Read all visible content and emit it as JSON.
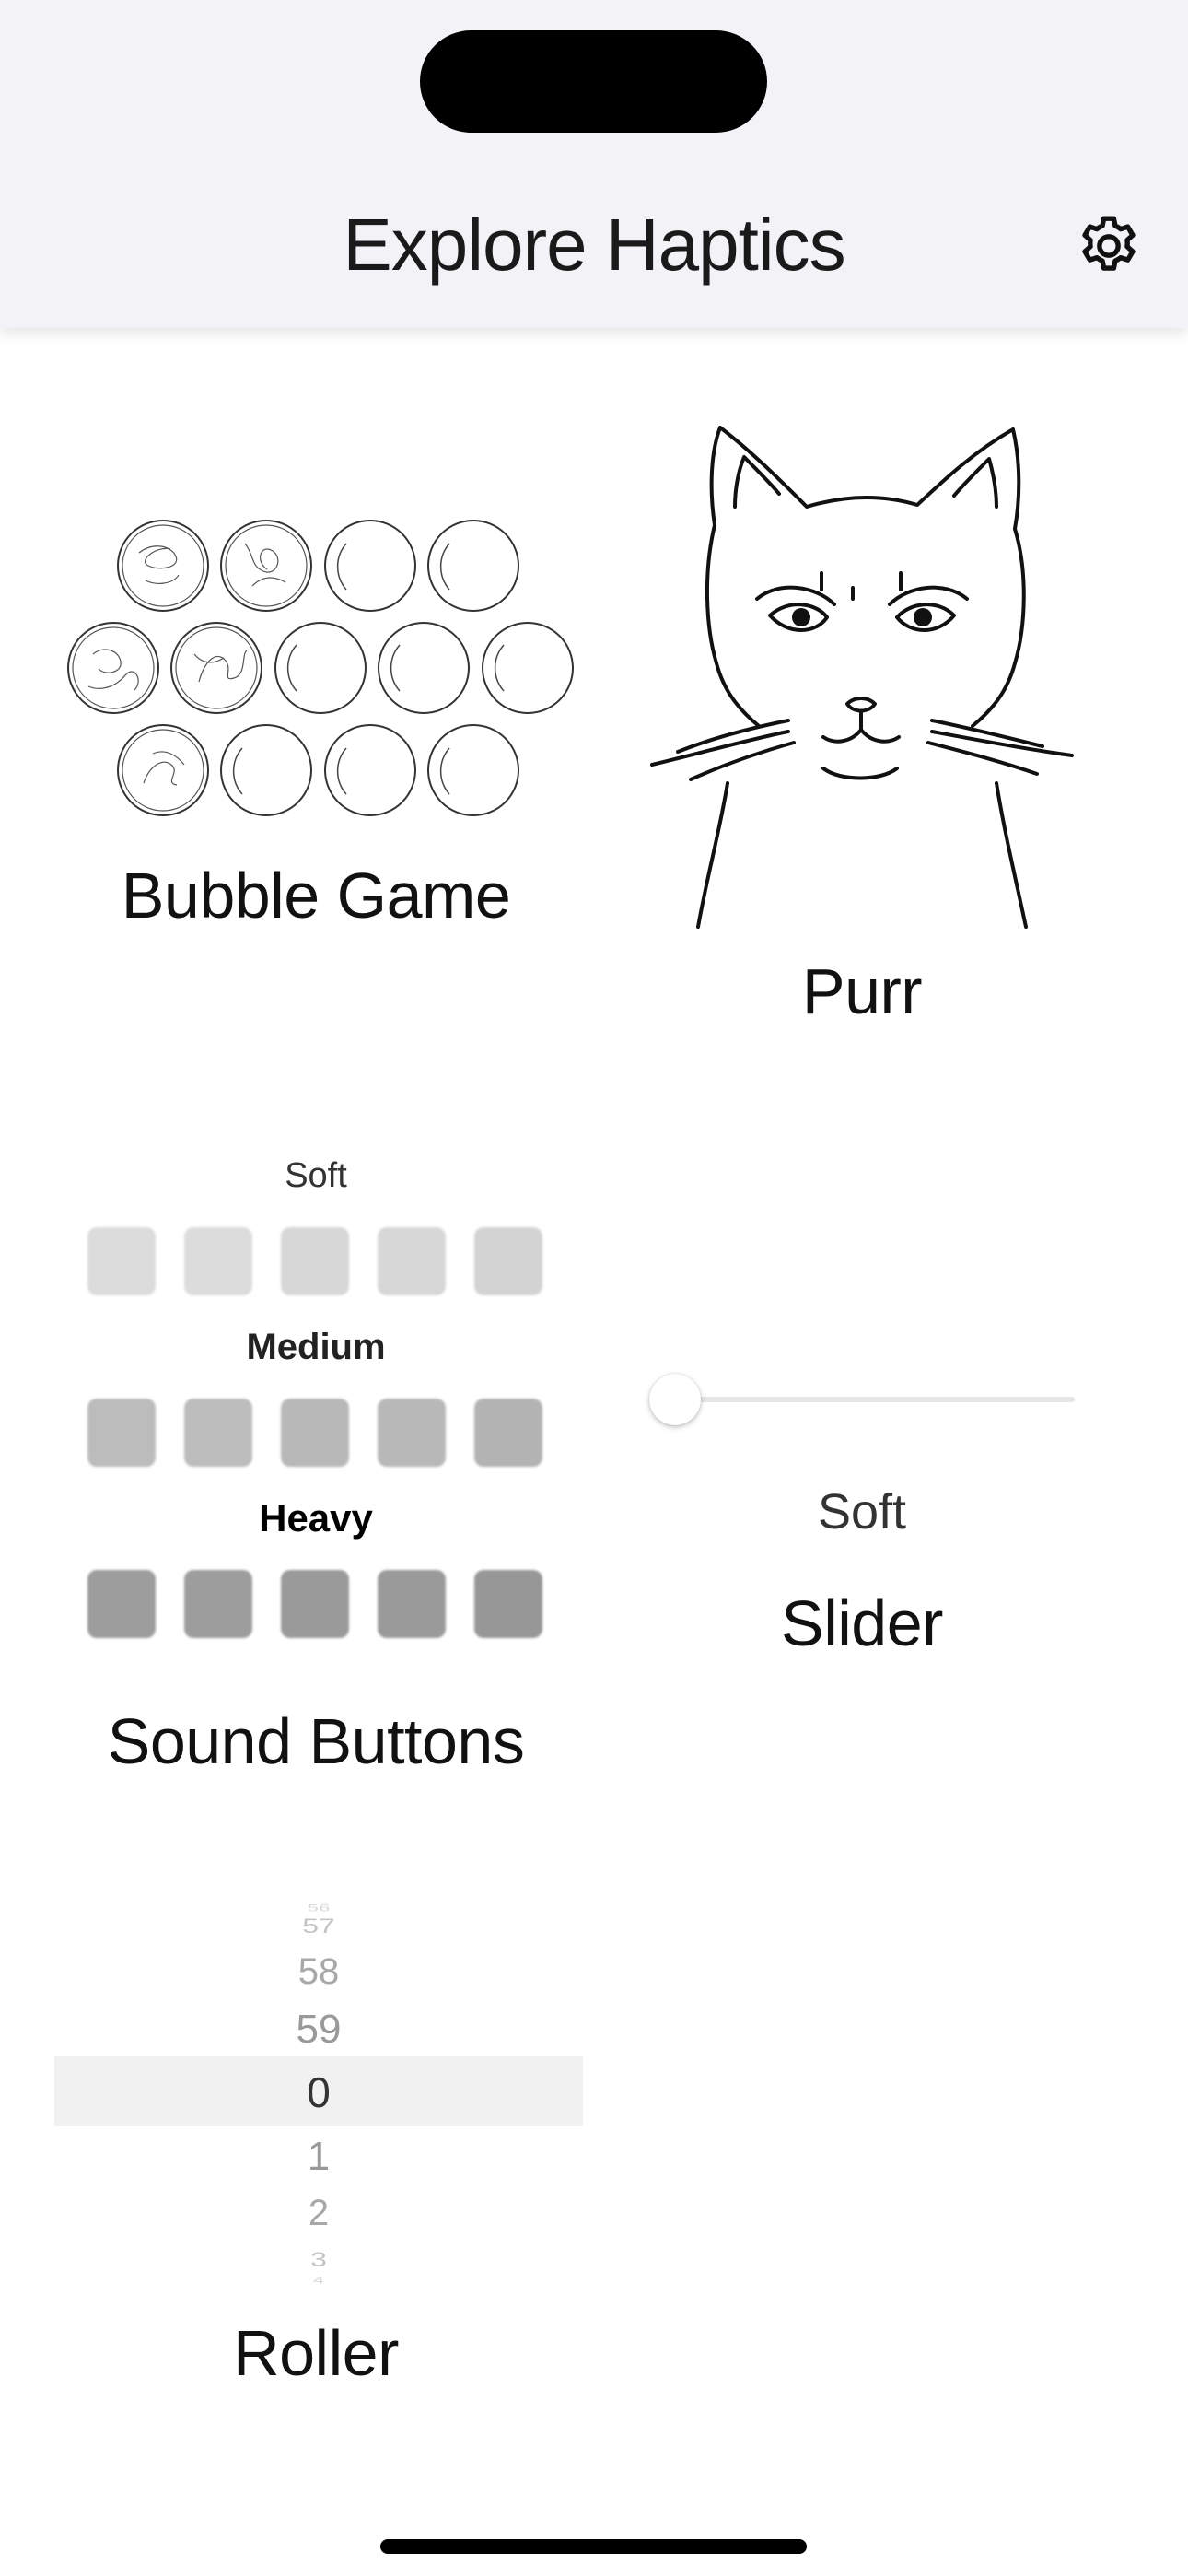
{
  "nav": {
    "title": "Explore Haptics",
    "settings_icon": "gear-icon"
  },
  "cards": {
    "bubble_game": {
      "label": "Bubble Game",
      "icon": "bubbles-illustration"
    },
    "purr": {
      "label": "Purr",
      "icon": "cat-illustration"
    },
    "sound_buttons": {
      "label": "Sound Buttons",
      "rows": [
        {
          "label": "Soft",
          "color": "#d8d8d8",
          "count": 5
        },
        {
          "label": "Medium",
          "color": "#b9b9b9",
          "count": 5
        },
        {
          "label": "Heavy",
          "color": "#9a9a9a",
          "count": 5
        }
      ]
    },
    "slider": {
      "label": "Slider",
      "value_label": "Soft",
      "value": 0
    },
    "roller": {
      "label": "Roller",
      "visible_values": [
        "56",
        "57",
        "58",
        "59",
        "0",
        "1",
        "2",
        "3",
        "4"
      ],
      "selected": "0"
    }
  }
}
